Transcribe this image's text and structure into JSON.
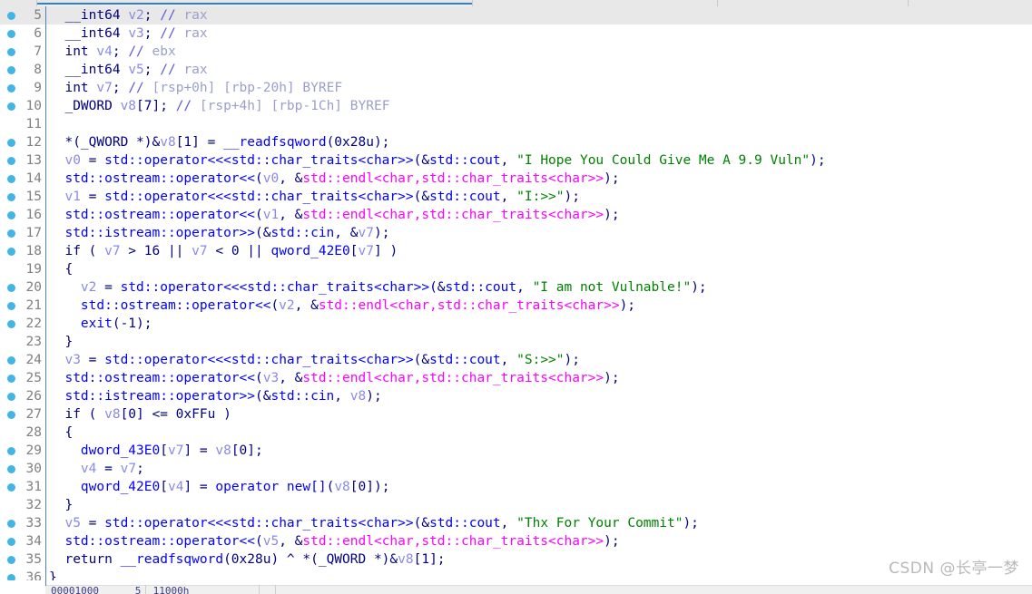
{
  "app": {
    "name": "IDA Pro Hex-Rays Pseudocode View",
    "watermark": "CSDN @长亭一梦"
  },
  "tabstrip": {
    "active_tab_accent": "#2f7fd1",
    "background": "#e7e7e7"
  },
  "theme": {
    "background": "#ffffff",
    "current_line_highlight": "#e8e8e8",
    "gutter_rule": "#4a7fc1",
    "breakpoint_dot": "#41b6e6",
    "line_number": "#808080",
    "keyword": "#000080",
    "variable": "#8a8ae6",
    "function": "#0000ff",
    "string": "#008000",
    "comment_marker": "#5a5ad0",
    "comment_body": "#9aa0c8",
    "magenta_symbol": "#ff00ff"
  },
  "statusbar": {
    "hex_ghost": "00001000      5  11000h"
  },
  "code": {
    "first_visible_line": 5,
    "current_line": 5,
    "lines": [
      {
        "n": 5,
        "bp": true,
        "current": true,
        "tokens": [
          {
            "t": "kw",
            "v": "  __int64 "
          },
          {
            "t": "var",
            "v": "v2"
          },
          {
            "t": "kw",
            "v": "; "
          },
          {
            "t": "cmtm",
            "v": "// "
          },
          {
            "t": "cmt",
            "v": "rax"
          }
        ]
      },
      {
        "n": 6,
        "bp": true,
        "current": false,
        "tokens": [
          {
            "t": "kw",
            "v": "  __int64 "
          },
          {
            "t": "var",
            "v": "v3"
          },
          {
            "t": "kw",
            "v": "; "
          },
          {
            "t": "cmtm",
            "v": "// "
          },
          {
            "t": "cmt",
            "v": "rax"
          }
        ]
      },
      {
        "n": 7,
        "bp": true,
        "current": false,
        "tokens": [
          {
            "t": "kw",
            "v": "  int "
          },
          {
            "t": "var",
            "v": "v4"
          },
          {
            "t": "kw",
            "v": "; "
          },
          {
            "t": "cmtm",
            "v": "// "
          },
          {
            "t": "cmt",
            "v": "ebx"
          }
        ]
      },
      {
        "n": 8,
        "bp": true,
        "current": false,
        "tokens": [
          {
            "t": "kw",
            "v": "  __int64 "
          },
          {
            "t": "var",
            "v": "v5"
          },
          {
            "t": "kw",
            "v": "; "
          },
          {
            "t": "cmtm",
            "v": "// "
          },
          {
            "t": "cmt",
            "v": "rax"
          }
        ]
      },
      {
        "n": 9,
        "bp": true,
        "current": false,
        "tokens": [
          {
            "t": "kw",
            "v": "  int "
          },
          {
            "t": "var",
            "v": "v7"
          },
          {
            "t": "kw",
            "v": "; "
          },
          {
            "t": "cmtm",
            "v": "// "
          },
          {
            "t": "cmt",
            "v": "[rsp+0h] [rbp-20h] BYREF"
          }
        ]
      },
      {
        "n": 10,
        "bp": true,
        "current": false,
        "tokens": [
          {
            "t": "kw",
            "v": "  _DWORD "
          },
          {
            "t": "var",
            "v": "v8"
          },
          {
            "t": "kw",
            "v": "[7]; "
          },
          {
            "t": "cmtm",
            "v": "// "
          },
          {
            "t": "cmt",
            "v": "[rsp+4h] [rbp-1Ch] BYREF"
          }
        ]
      },
      {
        "n": 11,
        "bp": false,
        "current": false,
        "tokens": []
      },
      {
        "n": 12,
        "bp": true,
        "current": false,
        "tokens": [
          {
            "t": "kw",
            "v": "  *(_QWORD *)&"
          },
          {
            "t": "var",
            "v": "v8"
          },
          {
            "t": "kw",
            "v": "[1] = "
          },
          {
            "t": "fn",
            "v": "__readfsqword"
          },
          {
            "t": "kw",
            "v": "(0x28u);"
          }
        ]
      },
      {
        "n": 13,
        "bp": true,
        "current": false,
        "tokens": [
          {
            "t": "kw",
            "v": "  "
          },
          {
            "t": "var",
            "v": "v0"
          },
          {
            "t": "kw",
            "v": " = "
          },
          {
            "t": "fn",
            "v": "std::operator<<<std::char_traits<char>>"
          },
          {
            "t": "kw",
            "v": "(&"
          },
          {
            "t": "fn",
            "v": "std::cout"
          },
          {
            "t": "kw",
            "v": ", "
          },
          {
            "t": "str",
            "v": "\"I Hope You Could Give Me A 9.9 Vuln\""
          },
          {
            "t": "kw",
            "v": ");"
          }
        ]
      },
      {
        "n": 14,
        "bp": true,
        "current": false,
        "tokens": [
          {
            "t": "kw",
            "v": "  "
          },
          {
            "t": "fn",
            "v": "std::ostream::operator<<"
          },
          {
            "t": "kw",
            "v": "("
          },
          {
            "t": "var",
            "v": "v0"
          },
          {
            "t": "kw",
            "v": ", &"
          },
          {
            "t": "mag",
            "v": "std::endl<char,std::char_traits<char>>"
          },
          {
            "t": "kw",
            "v": ");"
          }
        ]
      },
      {
        "n": 15,
        "bp": true,
        "current": false,
        "tokens": [
          {
            "t": "kw",
            "v": "  "
          },
          {
            "t": "var",
            "v": "v1"
          },
          {
            "t": "kw",
            "v": " = "
          },
          {
            "t": "fn",
            "v": "std::operator<<<std::char_traits<char>>"
          },
          {
            "t": "kw",
            "v": "(&"
          },
          {
            "t": "fn",
            "v": "std::cout"
          },
          {
            "t": "kw",
            "v": ", "
          },
          {
            "t": "str",
            "v": "\"I:>>\""
          },
          {
            "t": "kw",
            "v": ");"
          }
        ]
      },
      {
        "n": 16,
        "bp": true,
        "current": false,
        "tokens": [
          {
            "t": "kw",
            "v": "  "
          },
          {
            "t": "fn",
            "v": "std::ostream::operator<<"
          },
          {
            "t": "kw",
            "v": "("
          },
          {
            "t": "var",
            "v": "v1"
          },
          {
            "t": "kw",
            "v": ", &"
          },
          {
            "t": "mag",
            "v": "std::endl<char,std::char_traits<char>>"
          },
          {
            "t": "kw",
            "v": ");"
          }
        ]
      },
      {
        "n": 17,
        "bp": true,
        "current": false,
        "tokens": [
          {
            "t": "kw",
            "v": "  "
          },
          {
            "t": "fn",
            "v": "std::istream::operator>>"
          },
          {
            "t": "kw",
            "v": "(&"
          },
          {
            "t": "fn",
            "v": "std::cin"
          },
          {
            "t": "kw",
            "v": ", &"
          },
          {
            "t": "var",
            "v": "v7"
          },
          {
            "t": "kw",
            "v": ");"
          }
        ]
      },
      {
        "n": 18,
        "bp": true,
        "current": false,
        "tokens": [
          {
            "t": "kw",
            "v": "  if ( "
          },
          {
            "t": "var",
            "v": "v7"
          },
          {
            "t": "kw",
            "v": " > 16 || "
          },
          {
            "t": "var",
            "v": "v7"
          },
          {
            "t": "kw",
            "v": " < 0 || "
          },
          {
            "t": "fn",
            "v": "qword_42E0"
          },
          {
            "t": "kw",
            "v": "["
          },
          {
            "t": "var",
            "v": "v7"
          },
          {
            "t": "kw",
            "v": "] )"
          }
        ]
      },
      {
        "n": 19,
        "bp": false,
        "current": false,
        "tokens": [
          {
            "t": "kw",
            "v": "  {"
          }
        ]
      },
      {
        "n": 20,
        "bp": true,
        "current": false,
        "tokens": [
          {
            "t": "kw",
            "v": "    "
          },
          {
            "t": "var",
            "v": "v2"
          },
          {
            "t": "kw",
            "v": " = "
          },
          {
            "t": "fn",
            "v": "std::operator<<<std::char_traits<char>>"
          },
          {
            "t": "kw",
            "v": "(&"
          },
          {
            "t": "fn",
            "v": "std::cout"
          },
          {
            "t": "kw",
            "v": ", "
          },
          {
            "t": "str",
            "v": "\"I am not Vulnable!\""
          },
          {
            "t": "kw",
            "v": ");"
          }
        ]
      },
      {
        "n": 21,
        "bp": true,
        "current": false,
        "tokens": [
          {
            "t": "kw",
            "v": "    "
          },
          {
            "t": "fn",
            "v": "std::ostream::operator<<"
          },
          {
            "t": "kw",
            "v": "("
          },
          {
            "t": "var",
            "v": "v2"
          },
          {
            "t": "kw",
            "v": ", &"
          },
          {
            "t": "mag",
            "v": "std::endl<char,std::char_traits<char>>"
          },
          {
            "t": "kw",
            "v": ");"
          }
        ]
      },
      {
        "n": 22,
        "bp": true,
        "current": false,
        "tokens": [
          {
            "t": "kw",
            "v": "    "
          },
          {
            "t": "fn",
            "v": "exit"
          },
          {
            "t": "kw",
            "v": "(-1);"
          }
        ]
      },
      {
        "n": 23,
        "bp": false,
        "current": false,
        "tokens": [
          {
            "t": "kw",
            "v": "  }"
          }
        ]
      },
      {
        "n": 24,
        "bp": true,
        "current": false,
        "tokens": [
          {
            "t": "kw",
            "v": "  "
          },
          {
            "t": "var",
            "v": "v3"
          },
          {
            "t": "kw",
            "v": " = "
          },
          {
            "t": "fn",
            "v": "std::operator<<<std::char_traits<char>>"
          },
          {
            "t": "kw",
            "v": "(&"
          },
          {
            "t": "fn",
            "v": "std::cout"
          },
          {
            "t": "kw",
            "v": ", "
          },
          {
            "t": "str",
            "v": "\"S:>>\""
          },
          {
            "t": "kw",
            "v": ");"
          }
        ]
      },
      {
        "n": 25,
        "bp": true,
        "current": false,
        "tokens": [
          {
            "t": "kw",
            "v": "  "
          },
          {
            "t": "fn",
            "v": "std::ostream::operator<<"
          },
          {
            "t": "kw",
            "v": "("
          },
          {
            "t": "var",
            "v": "v3"
          },
          {
            "t": "kw",
            "v": ", &"
          },
          {
            "t": "mag",
            "v": "std::endl<char,std::char_traits<char>>"
          },
          {
            "t": "kw",
            "v": ");"
          }
        ]
      },
      {
        "n": 26,
        "bp": true,
        "current": false,
        "tokens": [
          {
            "t": "kw",
            "v": "  "
          },
          {
            "t": "fn",
            "v": "std::istream::operator>>"
          },
          {
            "t": "kw",
            "v": "(&"
          },
          {
            "t": "fn",
            "v": "std::cin"
          },
          {
            "t": "kw",
            "v": ", "
          },
          {
            "t": "var",
            "v": "v8"
          },
          {
            "t": "kw",
            "v": ");"
          }
        ]
      },
      {
        "n": 27,
        "bp": true,
        "current": false,
        "tokens": [
          {
            "t": "kw",
            "v": "  if ( "
          },
          {
            "t": "var",
            "v": "v8"
          },
          {
            "t": "kw",
            "v": "[0] <= 0xFFu )"
          }
        ]
      },
      {
        "n": 28,
        "bp": false,
        "current": false,
        "tokens": [
          {
            "t": "kw",
            "v": "  {"
          }
        ]
      },
      {
        "n": 29,
        "bp": true,
        "current": false,
        "tokens": [
          {
            "t": "kw",
            "v": "    "
          },
          {
            "t": "fn",
            "v": "dword_43E0"
          },
          {
            "t": "kw",
            "v": "["
          },
          {
            "t": "var",
            "v": "v7"
          },
          {
            "t": "kw",
            "v": "] = "
          },
          {
            "t": "var",
            "v": "v8"
          },
          {
            "t": "kw",
            "v": "[0];"
          }
        ]
      },
      {
        "n": 30,
        "bp": true,
        "current": false,
        "tokens": [
          {
            "t": "kw",
            "v": "    "
          },
          {
            "t": "var",
            "v": "v4"
          },
          {
            "t": "kw",
            "v": " = "
          },
          {
            "t": "var",
            "v": "v7"
          },
          {
            "t": "kw",
            "v": ";"
          }
        ]
      },
      {
        "n": 31,
        "bp": true,
        "current": false,
        "tokens": [
          {
            "t": "kw",
            "v": "    "
          },
          {
            "t": "fn",
            "v": "qword_42E0"
          },
          {
            "t": "kw",
            "v": "["
          },
          {
            "t": "var",
            "v": "v4"
          },
          {
            "t": "kw",
            "v": "] = "
          },
          {
            "t": "fn",
            "v": "operator new[]"
          },
          {
            "t": "kw",
            "v": "("
          },
          {
            "t": "var",
            "v": "v8"
          },
          {
            "t": "kw",
            "v": "[0]);"
          }
        ]
      },
      {
        "n": 32,
        "bp": false,
        "current": false,
        "tokens": [
          {
            "t": "kw",
            "v": "  }"
          }
        ]
      },
      {
        "n": 33,
        "bp": true,
        "current": false,
        "tokens": [
          {
            "t": "kw",
            "v": "  "
          },
          {
            "t": "var",
            "v": "v5"
          },
          {
            "t": "kw",
            "v": " = "
          },
          {
            "t": "fn",
            "v": "std::operator<<<std::char_traits<char>>"
          },
          {
            "t": "kw",
            "v": "(&"
          },
          {
            "t": "fn",
            "v": "std::cout"
          },
          {
            "t": "kw",
            "v": ", "
          },
          {
            "t": "str",
            "v": "\"Thx For Your Commit\""
          },
          {
            "t": "kw",
            "v": ");"
          }
        ]
      },
      {
        "n": 34,
        "bp": true,
        "current": false,
        "tokens": [
          {
            "t": "kw",
            "v": "  "
          },
          {
            "t": "fn",
            "v": "std::ostream::operator<<"
          },
          {
            "t": "kw",
            "v": "("
          },
          {
            "t": "var",
            "v": "v5"
          },
          {
            "t": "kw",
            "v": ", &"
          },
          {
            "t": "mag",
            "v": "std::endl<char,std::char_traits<char>>"
          },
          {
            "t": "kw",
            "v": ");"
          }
        ]
      },
      {
        "n": 35,
        "bp": true,
        "current": false,
        "tokens": [
          {
            "t": "kw",
            "v": "  return "
          },
          {
            "t": "fn",
            "v": "__readfsqword"
          },
          {
            "t": "kw",
            "v": "(0x28u) ^ *(_QWORD *)&"
          },
          {
            "t": "var",
            "v": "v8"
          },
          {
            "t": "kw",
            "v": "[1];"
          }
        ]
      },
      {
        "n": 36,
        "bp": true,
        "current": false,
        "tokens": [
          {
            "t": "kw",
            "v": "}"
          }
        ]
      }
    ]
  }
}
